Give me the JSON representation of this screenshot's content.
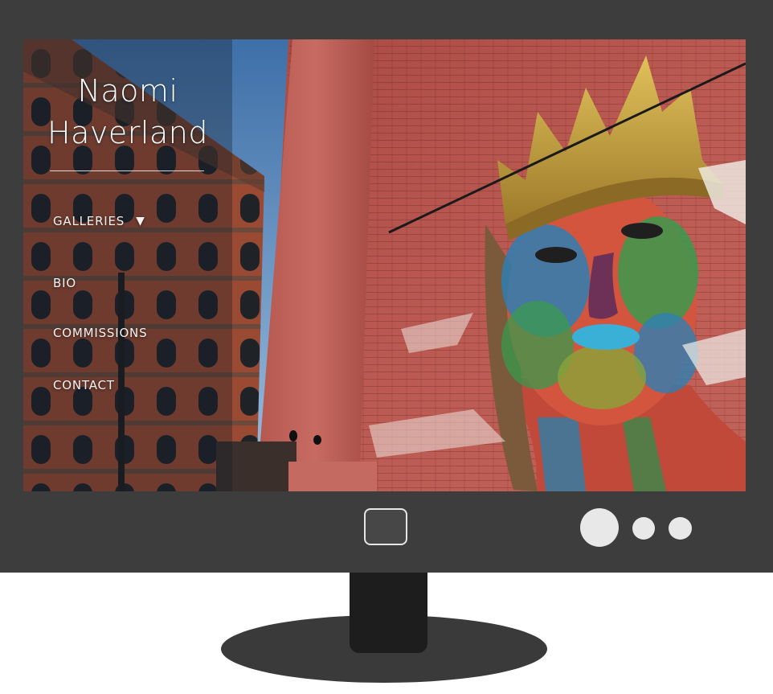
{
  "site": {
    "title_line1": "Naomi",
    "title_line2": "Haverland"
  },
  "nav": {
    "items": [
      {
        "label": "GALLERIES",
        "has_dropdown": true,
        "dropdown_icon": "triangle-down-icon"
      },
      {
        "label": "BIO"
      },
      {
        "label": "COMMISSIONS"
      },
      {
        "label": "CONTACT"
      }
    ]
  },
  "hero_image": {
    "subject": "street mural of a face with a gold crown painted on a red brick wall"
  },
  "colors": {
    "bezel": "#3d3d3d",
    "stand": "#1d1d1d",
    "brick_red": "#b8554e",
    "crown_gold": "#c9a33c",
    "nav_text": "#f2f2f2"
  }
}
